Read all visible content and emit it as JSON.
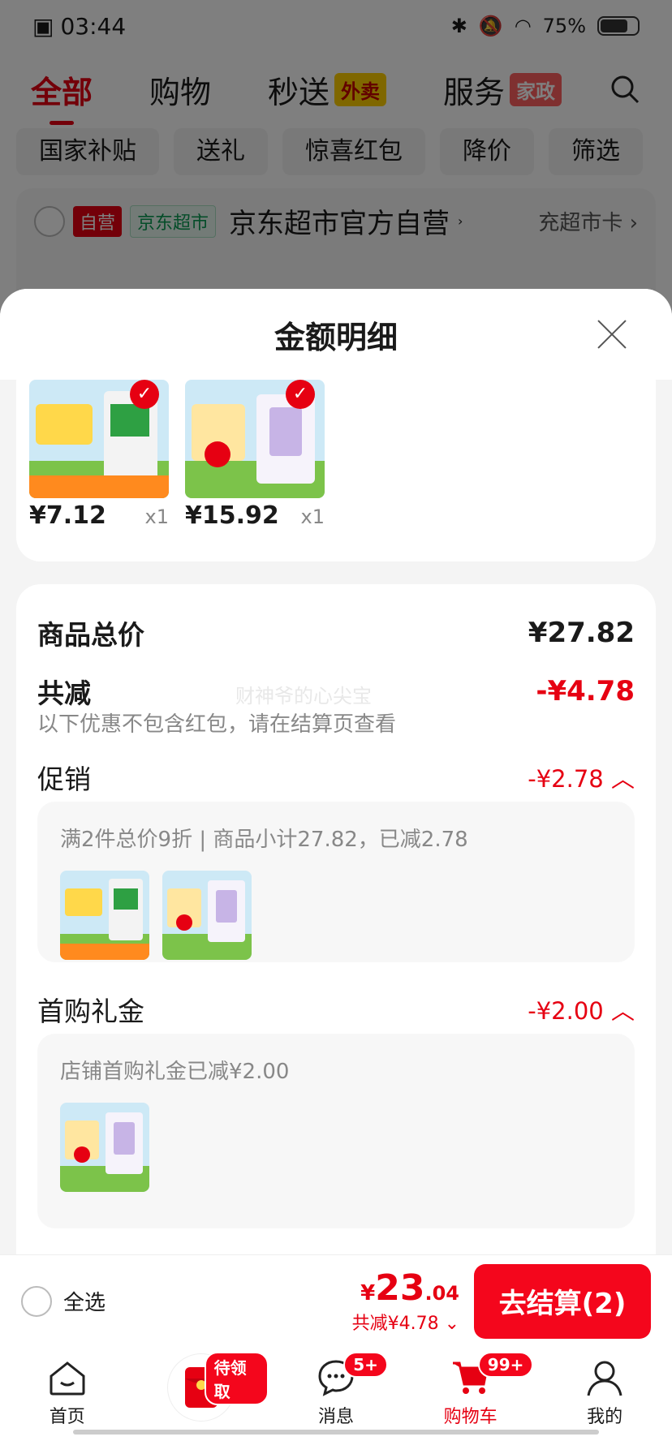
{
  "status_bar": {
    "time": "03:44",
    "battery": "75%",
    "battery_level": 0.75
  },
  "top_tabs": [
    {
      "label": "全部",
      "active": true,
      "badge": ""
    },
    {
      "label": "购物",
      "active": false,
      "badge": ""
    },
    {
      "label": "秒送",
      "active": false,
      "badge": "外卖"
    },
    {
      "label": "服务",
      "active": false,
      "badge": "家政"
    }
  ],
  "chips": [
    "国家补贴",
    "送礼",
    "惊喜红包",
    "降价",
    "筛选"
  ],
  "shop": {
    "tag1": "自营",
    "tag2": "京东超市",
    "name": "京东超市官方自营",
    "link": "充超市卡"
  },
  "sheet": {
    "title": "金额明细",
    "products": [
      {
        "price": "¥7.12",
        "qty": "x1"
      },
      {
        "price": "¥15.92",
        "qty": "x1"
      }
    ],
    "total_label": "商品总价",
    "total_value": "¥27.82",
    "discount_label": "共减",
    "discount_value": "-¥4.78",
    "discount_note": "以下优惠不包含红包，请在结算页查看",
    "watermark": "财神爷的心尖宝",
    "promo_label": "促销",
    "promo_value": "-¥2.78",
    "promo_detail": "满2件总价9折 | 商品小计27.82，已减2.78",
    "gift_label": "首购礼金",
    "gift_value": "-¥2.00",
    "gift_detail": "店铺首购礼金已减¥2.00"
  },
  "checkout": {
    "select_all": "全选",
    "currency": "¥",
    "total_int": "23",
    "total_dec": ".04",
    "saved": "共减¥4.78",
    "button": "去结算(2)"
  },
  "bottom_nav": [
    {
      "label": "首页",
      "badge": ""
    },
    {
      "label": "",
      "badge": "待领取"
    },
    {
      "label": "消息",
      "badge": "5+"
    },
    {
      "label": "购物车",
      "badge": "99+"
    },
    {
      "label": "我的",
      "badge": ""
    }
  ]
}
